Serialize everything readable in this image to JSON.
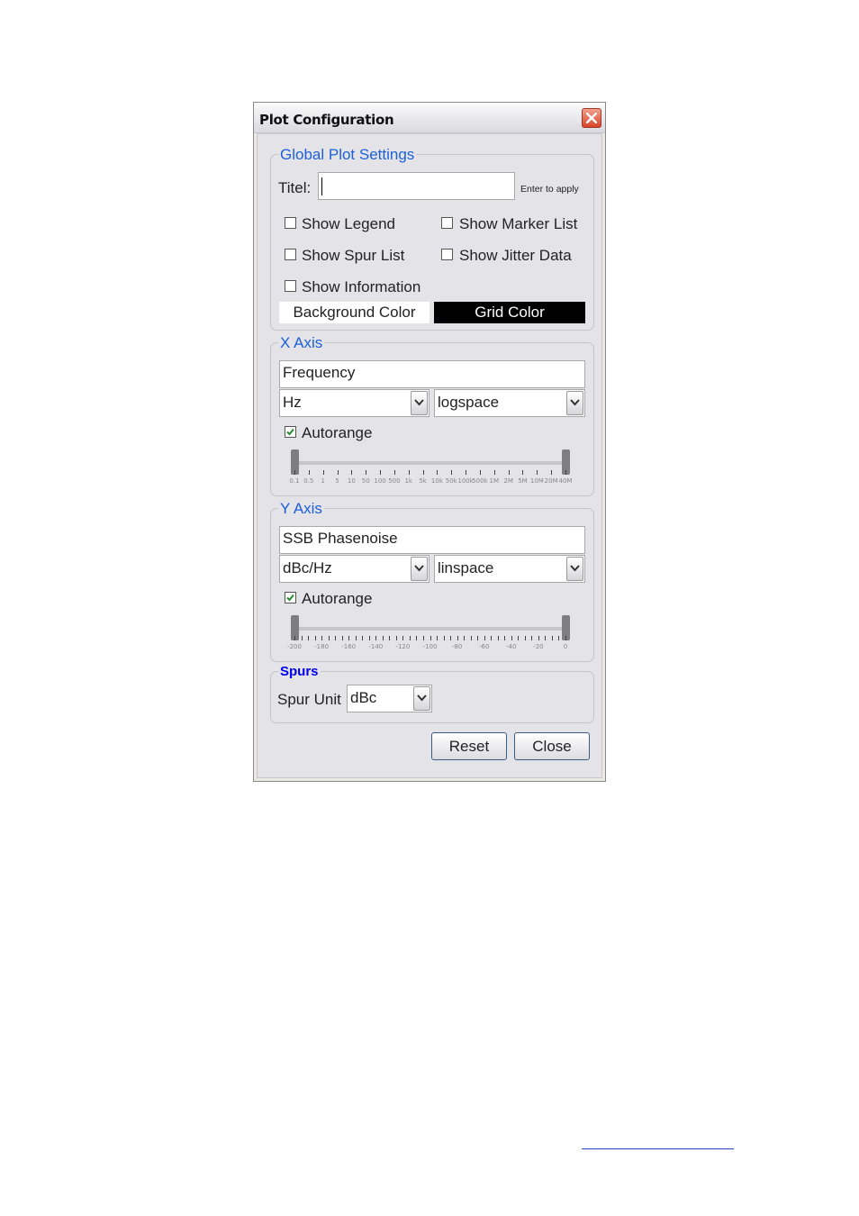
{
  "window": {
    "title": "Plot Configuration"
  },
  "global": {
    "legend": "Global Plot Settings",
    "title_label": "Titel:",
    "title_value": "",
    "enter_hint": "Enter to apply",
    "checkboxes": [
      {
        "label": "Show Legend",
        "checked": false
      },
      {
        "label": "Show Marker List",
        "checked": false
      },
      {
        "label": "Show Spur List",
        "checked": false
      },
      {
        "label": "Show Jitter Data",
        "checked": false
      },
      {
        "label": "Show Information",
        "checked": false
      }
    ],
    "background_color_label": "Background Color",
    "grid_color_label": "Grid Color",
    "colors": {
      "background_button": "#ffffff",
      "grid_button": "#000000"
    }
  },
  "x_axis": {
    "legend": "X Axis",
    "label_value": "Frequency",
    "unit": "Hz",
    "spacing": "logspace",
    "autorange_label": "Autorange",
    "autorange_checked": true,
    "tick_labels": [
      "0.1",
      "0.5",
      "1",
      "5",
      "10",
      "50",
      "100",
      "500",
      "1k",
      "5k",
      "10k",
      "50k",
      "100k",
      "500k",
      "1M",
      "2M",
      "5M",
      "10M",
      "20M",
      "40M"
    ],
    "range_fraction": [
      0,
      1
    ]
  },
  "y_axis": {
    "legend": "Y Axis",
    "label_value": "SSB Phasenoise",
    "unit": "dBc/Hz",
    "spacing": "linspace",
    "autorange_label": "Autorange",
    "autorange_checked": true,
    "tick_labels": [
      "-200",
      "-180",
      "-160",
      "-140",
      "-120",
      "-100",
      "-80",
      "-60",
      "-40",
      "-20",
      "0"
    ],
    "range_fraction": [
      0,
      1
    ]
  },
  "spurs": {
    "legend": "Spurs",
    "unit_label": "Spur Unit",
    "unit_value": "dBc"
  },
  "buttons": {
    "reset": "Reset",
    "close": "Close"
  },
  "accent": "#1c5fd8"
}
